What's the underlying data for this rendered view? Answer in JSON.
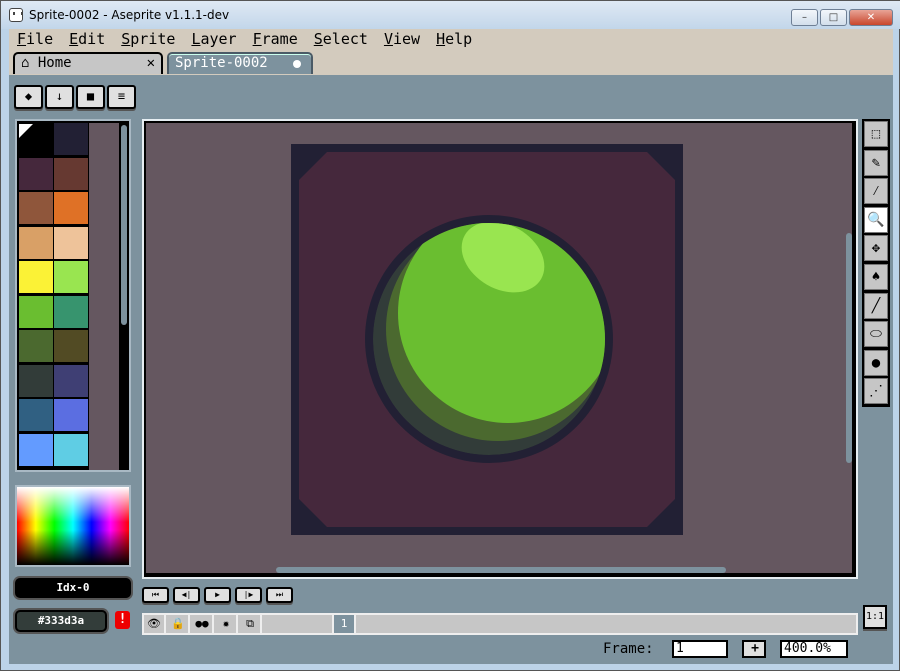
{
  "window": {
    "title": "Sprite-0002 - Aseprite v1.1.1-dev",
    "minimize": "–",
    "maximize": "□",
    "close": "✕"
  },
  "menu": [
    "File",
    "Edit",
    "Sprite",
    "Layer",
    "Frame",
    "Select",
    "View",
    "Help"
  ],
  "tabs": [
    {
      "label": "Home",
      "icon": "home-icon",
      "close": "✕"
    },
    {
      "label": "Sprite-0002",
      "modified": true
    }
  ],
  "toolbar_buttons": [
    {
      "icon": "eraser-icon",
      "glyph": "◆"
    },
    {
      "icon": "arrow-down-icon",
      "glyph": "↓"
    },
    {
      "icon": "folder-icon",
      "glyph": "■"
    },
    {
      "icon": "menu-icon",
      "glyph": "≡"
    }
  ],
  "palette": [
    "#000000",
    "#222034",
    "#45283c",
    "#663931",
    "#8f563b",
    "#df7126",
    "#d9a066",
    "#eec39a",
    "#fbf236",
    "#99e550",
    "#6abe30",
    "#37946e",
    "#4b692f",
    "#524b24",
    "#323c39",
    "#3f3f74",
    "#306082",
    "#5b6ee1",
    "#639bff",
    "#5fcde4"
  ],
  "color_index": "Idx-0",
  "color_hex": "#333d3a",
  "warning_icon": "!",
  "tools": [
    "rectangular-marquee",
    "pencil",
    "eyedropper",
    "zoom",
    "move",
    "paint-bucket",
    "line",
    "ellipse",
    "contour",
    "spray"
  ],
  "selected_tool": "zoom",
  "playback": [
    "⏮",
    "◀|",
    "▶",
    "|▶",
    "⏭"
  ],
  "layer_icons": [
    "eye-icon",
    "lock-icon",
    "onion-skin-icon",
    "gear-icon",
    "layers-icon"
  ],
  "frame_cell": "1",
  "zoom_reset": "1:1",
  "status": {
    "frame_label": "Frame:",
    "frame_value": "1",
    "add": "+",
    "zoom": "400.0%"
  },
  "sprite_colors": {
    "background": "#45283c",
    "outline": "#222034",
    "ball": "#6abe30",
    "highlight": "#99e550",
    "shade": "#4b692f",
    "shadow": "#323c39",
    "canvas_bg": "#655760"
  }
}
